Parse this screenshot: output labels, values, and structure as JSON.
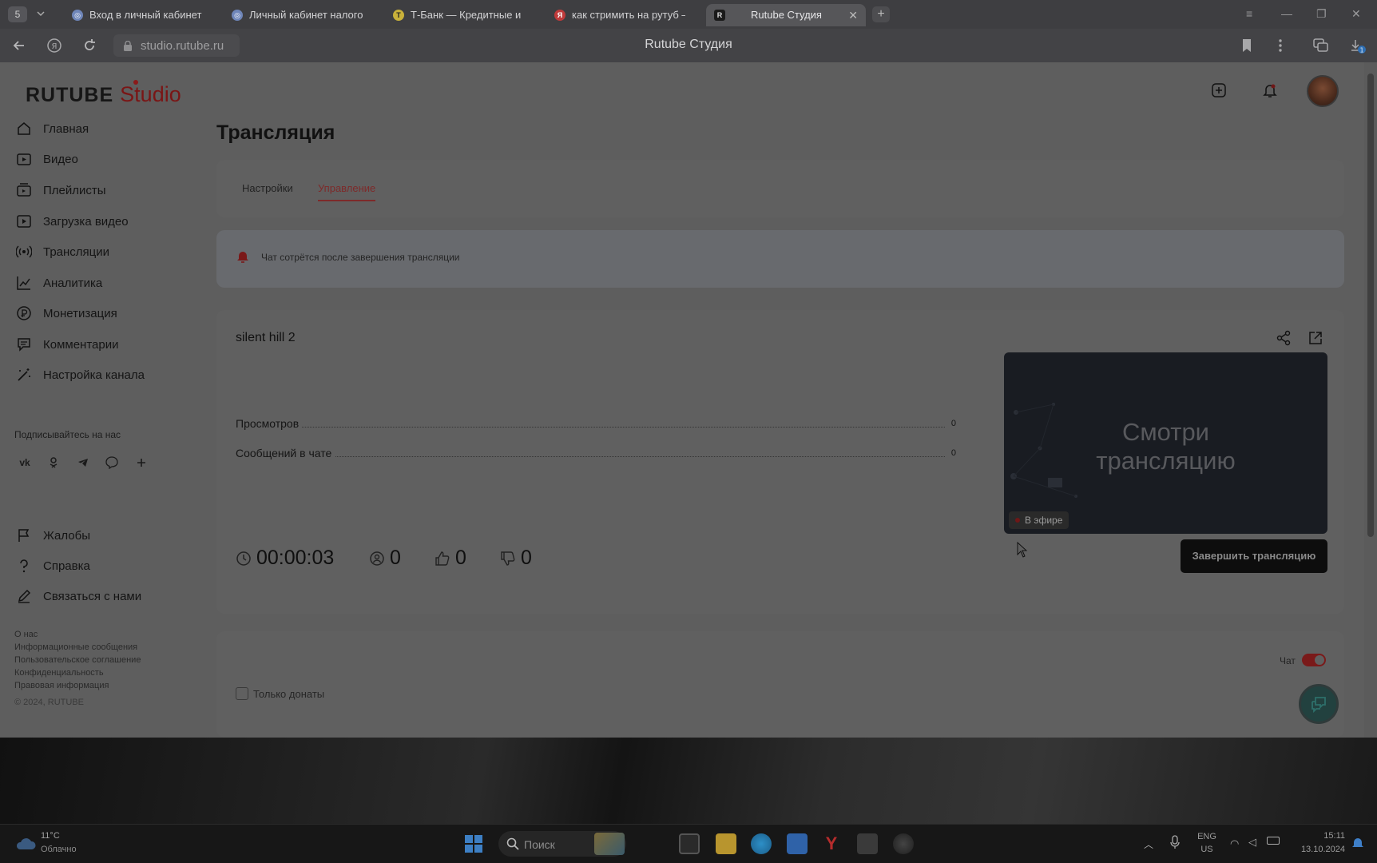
{
  "browser": {
    "tab_count": "5",
    "tabs": [
      {
        "title": "Вход в личный кабинет ·",
        "icon": "globe-icon"
      },
      {
        "title": "Личный кабинет налогоп",
        "icon": "globe-icon"
      },
      {
        "title": "Т-Банк — Кредитные и де",
        "icon": "tbank-icon"
      },
      {
        "title": "как стримить на рутуб —",
        "icon": "yandex-icon"
      },
      {
        "title": "Rutube Студия",
        "icon": "rutube-icon"
      }
    ],
    "url": "studio.rutube.ru",
    "page_title": "Rutube Студия",
    "downloads_badge": "1"
  },
  "logo": {
    "brand": "RUTUBE",
    "product": "Studio"
  },
  "sidebar": {
    "items": [
      {
        "label": "Главная",
        "icon": "home-icon"
      },
      {
        "label": "Видео",
        "icon": "video-icon"
      },
      {
        "label": "Плейлисты",
        "icon": "playlist-icon"
      },
      {
        "label": "Загрузка видео",
        "icon": "upload-icon"
      },
      {
        "label": "Трансляции",
        "icon": "broadcast-icon"
      },
      {
        "label": "Аналитика",
        "icon": "analytics-icon"
      },
      {
        "label": "Монетизация",
        "icon": "money-icon"
      },
      {
        "label": "Комментарии",
        "icon": "comments-icon"
      },
      {
        "label": "Настройка канала",
        "icon": "wand-icon"
      }
    ],
    "subscribe_title": "Подписывайтесь на нас",
    "socials": [
      "vk",
      "ok",
      "telegram",
      "viber",
      "more"
    ],
    "bottom_items": [
      {
        "label": "Жалобы",
        "icon": "flag-icon"
      },
      {
        "label": "Справка",
        "icon": "help-icon"
      },
      {
        "label": "Связаться с нами",
        "icon": "edit-icon"
      }
    ],
    "footer_links": [
      "О нас",
      "Информационные сообщения",
      "Пользовательское соглашение",
      "Конфиденциальность",
      "Правовая информация"
    ],
    "copyright": "© 2024, RUTUBE"
  },
  "main": {
    "title": "Трансляция",
    "tabs": [
      {
        "label": "Настройки"
      },
      {
        "label": "Управление"
      }
    ],
    "active_tab": 1,
    "notice": "Чат сотрётся после завершения трансляции",
    "stream": {
      "name": "silent hill 2",
      "stats": [
        {
          "label": "Просмотров",
          "value": "0"
        },
        {
          "label": "Сообщений в чате",
          "value": "0"
        }
      ],
      "duration": "00:00:03",
      "viewers": "0",
      "likes": "0",
      "dislikes": "0",
      "preview_text_line1": "Смотри",
      "preview_text_line2": "трансляцию",
      "live_label": "В эфире",
      "end_button": "Завершить трансляцию"
    },
    "chat": {
      "label": "Чат",
      "enabled": true,
      "donations_only_label": "Только донаты",
      "donations_only_checked": false
    }
  },
  "taskbar": {
    "weather_temp": "11°C",
    "weather_desc": "Облачно",
    "search_placeholder": "Поиск",
    "lang_line1": "ENG",
    "lang_line2": "US",
    "time": "15:11",
    "date": "13.10.2024"
  },
  "colors": {
    "accent": "#7d2a2a",
    "overlay_page": "#5e5e5e",
    "stream_button": "#0d0d0d"
  }
}
